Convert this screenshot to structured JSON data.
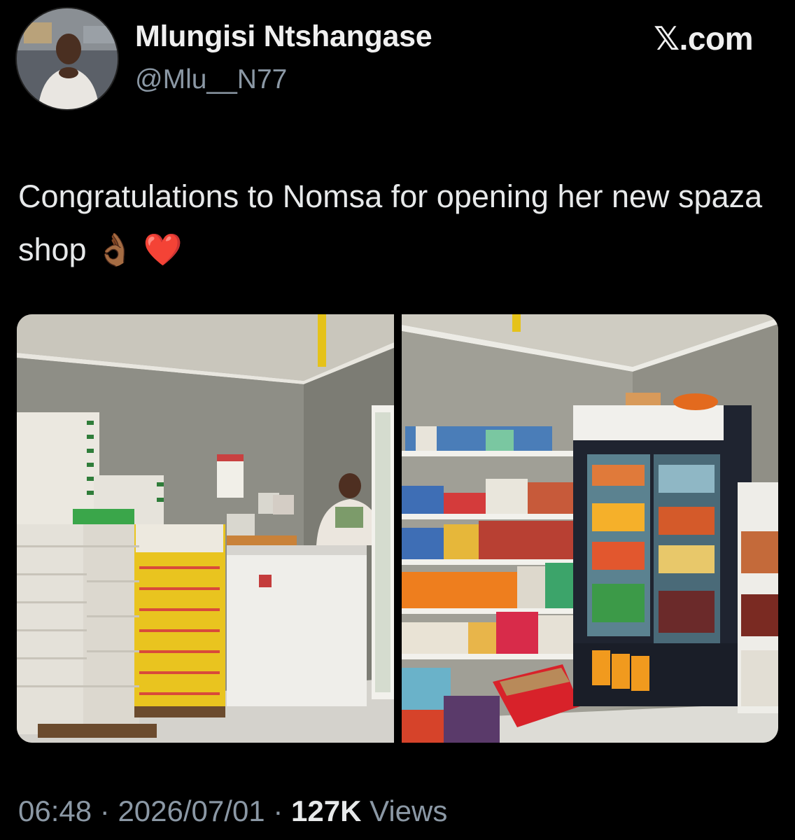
{
  "author": {
    "display_name": "Mlungisi Ntshangase",
    "handle": "@Mlu__N77"
  },
  "source_logo": "𝕏.com",
  "tweet": {
    "text": "Congratulations to Nomsa for opening her new spaza shop",
    "emojis": [
      "👌🏾",
      "❤️"
    ]
  },
  "media": [
    {
      "icon": "shop-counter-photo"
    },
    {
      "icon": "shop-shelves-photo"
    }
  ],
  "footer": {
    "time": "06:48",
    "separator": "·",
    "date": "2026/07/01",
    "views_count": "127K",
    "views_label": "Views"
  }
}
